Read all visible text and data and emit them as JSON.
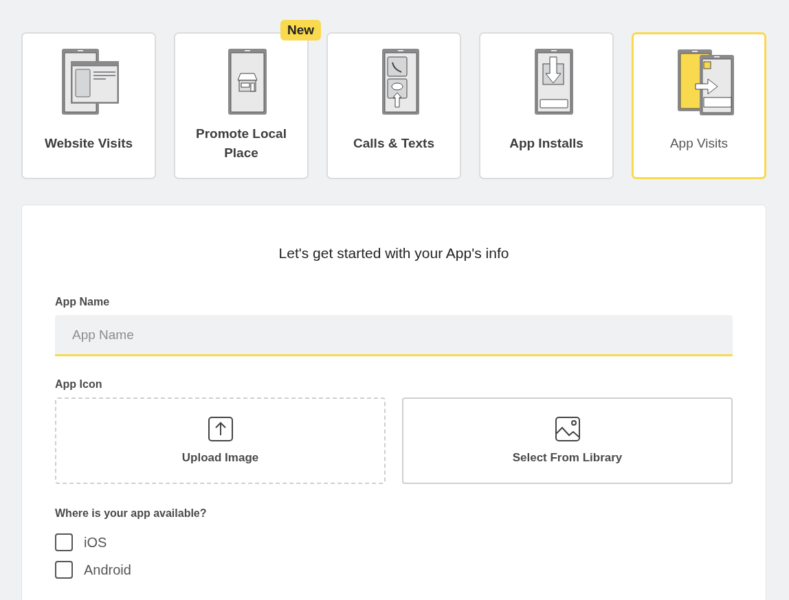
{
  "objectives": [
    {
      "kind": "website",
      "label": "Website Visits",
      "selected": false
    },
    {
      "kind": "local",
      "label": "Promote Local Place",
      "selected": false,
      "badge": "New"
    },
    {
      "kind": "calls",
      "label": "Calls & Texts",
      "selected": false
    },
    {
      "kind": "installs",
      "label": "App Installs",
      "selected": false
    },
    {
      "kind": "visits",
      "label": "App Visits",
      "selected": true
    }
  ],
  "form": {
    "title": "Let's get started with your App's info",
    "app_name": {
      "label": "App Name",
      "placeholder": "App Name"
    },
    "app_icon": {
      "label": "App Icon",
      "options": [
        {
          "kind": "upload",
          "label": "Upload Image"
        },
        {
          "kind": "library",
          "label": "Select From Library"
        }
      ]
    },
    "availability": {
      "label": "Where is your app available?",
      "options": [
        {
          "label": "iOS",
          "checked": false
        },
        {
          "label": "Android",
          "checked": false
        }
      ]
    }
  }
}
